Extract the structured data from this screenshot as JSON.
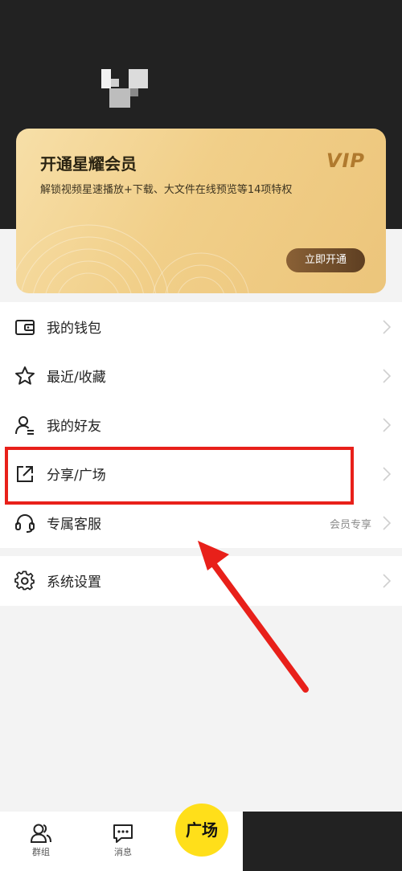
{
  "vip_card": {
    "title": "开通星耀会员",
    "description": "解锁视频星速播放+下载、大文件在线预览等14项特权",
    "logo_text": "VIP",
    "cta_label": "立即开通"
  },
  "menu": {
    "items": [
      {
        "label": "我的钱包",
        "icon": "wallet-icon"
      },
      {
        "label": "最近/收藏",
        "icon": "star-icon"
      },
      {
        "label": "我的好友",
        "icon": "friend-icon"
      },
      {
        "label": "分享/广场",
        "icon": "share-icon"
      },
      {
        "label": "专属客服",
        "icon": "headset-icon",
        "extra": "会员专享"
      }
    ],
    "settings": {
      "label": "系统设置",
      "icon": "gear-icon"
    }
  },
  "annotation": {
    "highlight_color": "#e8201a"
  },
  "tabbar": {
    "tabs": [
      {
        "label": "群组",
        "icon": "group-icon"
      },
      {
        "label": "消息",
        "icon": "message-icon"
      }
    ],
    "center_label": "广场",
    "center_color": "#ffdf1a"
  }
}
